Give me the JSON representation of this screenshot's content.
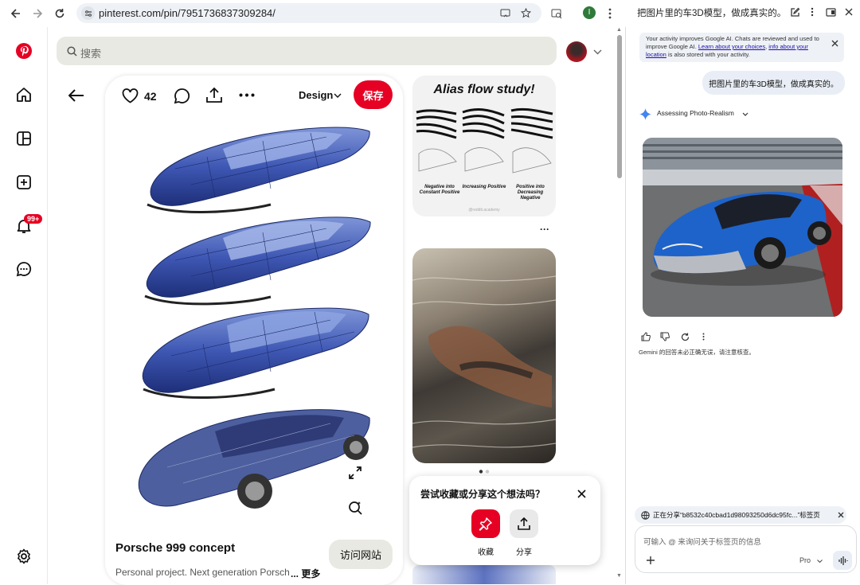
{
  "browser": {
    "url": "pinterest.com/pin/7951736837309284/",
    "profile_initial": "I"
  },
  "pinterest": {
    "search_placeholder": "搜索",
    "notification_badge": "99+",
    "pin": {
      "like_count": "42",
      "board": "Design",
      "save_label": "保存",
      "title": "Porsche 999 concept",
      "description": "Personal project. Next generation Porsche",
      "more_label": "... 更多",
      "visit_label": "访问网站"
    },
    "side_pin_1": {
      "title": "Alias flow study!",
      "captions": [
        "Negative into Constant Positive",
        "Increasing Positive",
        "Positive into Decreasing Negative"
      ],
      "watermark": "@reddit.academy"
    },
    "popup": {
      "question": "尝试收藏或分享这个想法吗？",
      "save_label": "收藏",
      "share_label": "分享"
    }
  },
  "gemini": {
    "title": "把图片里的车3D模型，做成真实的。",
    "notice_prefix": "Your activity improves Google AI. Chats are reviewed and used to improve Google AI. ",
    "notice_link1": "Learn about your choices",
    "notice_mid": ", ",
    "notice_link2": "info about your location",
    "notice_suffix": " is also stored with your activity.",
    "user_message": "把图片里的车3D模型，做成真实的。",
    "thinking_label": "Assessing Photo-Realism",
    "disclaimer": "Gemini 的回答未必正确无误，请注意核查。",
    "share_chip": "正在分享“b8532c40cbad1d98093250d6dc95fc...”标签页",
    "input_placeholder": "可输入 @ 来询问关于标签页的信息",
    "model_label": "Pro"
  },
  "colors": {
    "pinterest_red": "#e60023",
    "gemini_blue": "#4285f4"
  }
}
